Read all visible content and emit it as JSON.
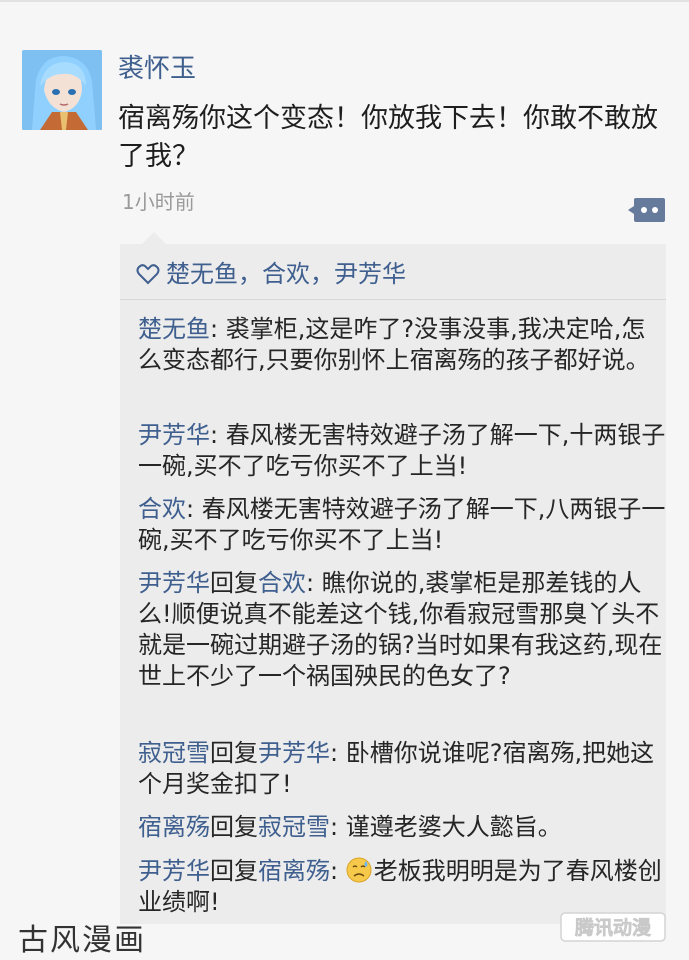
{
  "post": {
    "poster_name": "裘怀玉",
    "content": "宿离殇你这个变态！你放我下去！你敢不敢放了我？",
    "time": "1小时前"
  },
  "likes": {
    "icon": "heart-icon",
    "names": "楚无鱼，合欢，尹芳华"
  },
  "comments": [
    {
      "author": "楚无鱼",
      "reply_word": "",
      "reply_to": "",
      "text": ": 裘掌柜,这是咋了?没事没事,我决定哈,怎么变态都行,只要你别怀上宿离殇的孩子都好说。"
    },
    {
      "author": "尹芳华",
      "reply_word": "",
      "reply_to": "",
      "text": ": 春风楼无害特效避子汤了解一下,十两银子一碗,买不了吃亏你买不了上当!"
    },
    {
      "author": "合欢",
      "reply_word": "",
      "reply_to": "",
      "text": ": 春风楼无害特效避子汤了解一下,八两银子一碗,买不了吃亏你买不了上当!"
    },
    {
      "author": "尹芳华",
      "reply_word": "回复",
      "reply_to": "合欢",
      "text": ": 瞧你说的,裘掌柜是那差钱的人么!顺便说真不能差这个钱,你看寂冠雪那臭丫头不就是一碗过期避子汤的锅?当时如果有我这药,现在世上不少了一个祸国殃民的色女了?"
    },
    {
      "author": "寂冠雪",
      "reply_word": "回复",
      "reply_to": "尹芳华",
      "text": ": 卧槽你说谁呢?宿离殇,把她这个月奖金扣了!"
    },
    {
      "author": "宿离殇",
      "reply_word": "回复",
      "reply_to": "寂冠雪",
      "text": ": 谨遵老婆大人懿旨。"
    },
    {
      "author": "尹芳华",
      "reply_word": "回复",
      "reply_to": "宿离殇",
      "text": "老板我明明是为了春风楼创业绩啊!",
      "prefix": ": ",
      "emoji": "sad-sweat-emoji"
    }
  ],
  "watermark": {
    "left_text": "古风漫画",
    "right_text": "腾讯动漫"
  },
  "colors": {
    "link_blue": "#3f5f8f",
    "comment_bg": "#ececec",
    "page_bg": "#f6f6f6"
  }
}
